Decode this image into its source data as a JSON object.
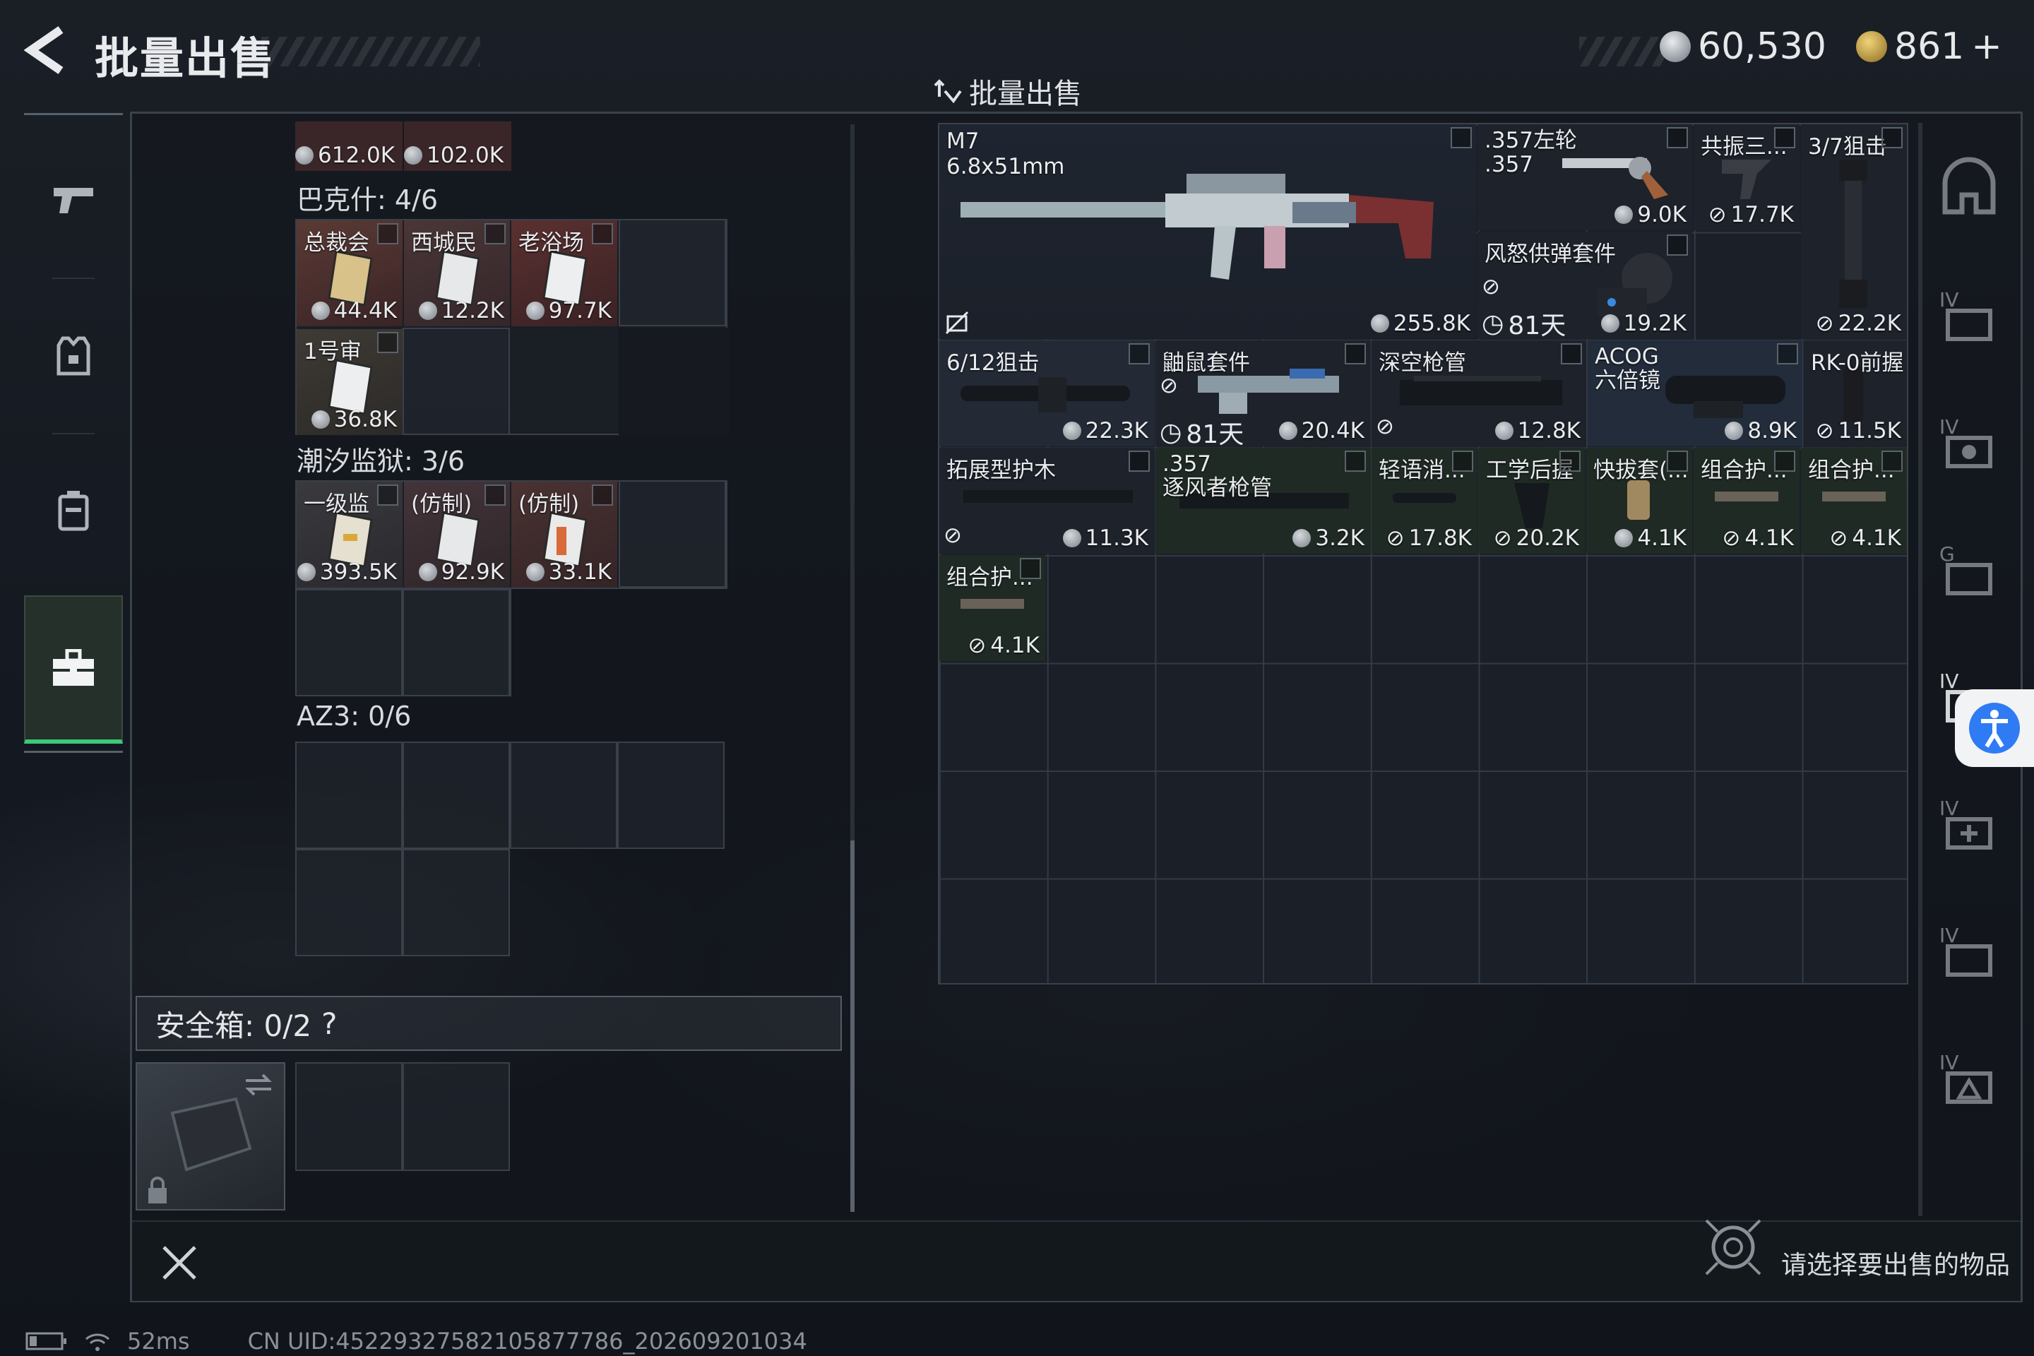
{
  "header": {
    "title": "批量出售",
    "subtitle": "批量出售",
    "currency_main": "60,530",
    "currency_secondary": "861",
    "add_label": "+"
  },
  "left_panel": {
    "top_row_prices": [
      "612.0K",
      "102.0K"
    ],
    "sections": [
      {
        "label": "巴克什: 4/6",
        "items": [
          {
            "name": "总裁会",
            "price": "44.4K"
          },
          {
            "name": "西城民",
            "price": "12.2K"
          },
          {
            "name": "老浴场",
            "price": "97.7K"
          },
          {
            "name": "1号审",
            "price": "36.8K"
          }
        ]
      },
      {
        "label": "潮汐监狱: 3/6",
        "items": [
          {
            "name": "一级监",
            "price": "393.5K"
          },
          {
            "name": "(仿制)",
            "price": "92.9K"
          },
          {
            "name": "(仿制)",
            "price": "33.1K"
          }
        ]
      },
      {
        "label": "AZ3: 0/6",
        "items": []
      }
    ],
    "safe_box_label": "安全箱: 0/2",
    "safe_box_help": "?"
  },
  "right_panel": {
    "items": [
      {
        "name": "M7\n6.8x51mm",
        "price": "255.8K"
      },
      {
        "name": ".357左轮\n.357",
        "price": "9.0K"
      },
      {
        "name": "共振三...",
        "price": "17.7K"
      },
      {
        "name": "3/7狙击",
        "price": "22.2K"
      },
      {
        "name": "风怒供弹套件",
        "price": "19.2K",
        "timer": "81天"
      },
      {
        "name": "6/12狙击",
        "price": "22.3K"
      },
      {
        "name": "鼬鼠套件",
        "price": "20.4K",
        "timer": "81天"
      },
      {
        "name": "深空枪管",
        "price": "12.8K"
      },
      {
        "name": "ACOG\n六倍镜",
        "price": "8.9K"
      },
      {
        "name": "RK-0前握",
        "price": "11.5K"
      },
      {
        "name": "拓展型护木",
        "price": "11.3K"
      },
      {
        "name": ".357\n逐风者枪管",
        "price": "3.2K"
      },
      {
        "name": "轻语消...",
        "price": "17.8K"
      },
      {
        "name": "工学后握",
        "price": "20.2K"
      },
      {
        "name": "快拔套(...",
        "price": "4.1K"
      },
      {
        "name": "组合护...",
        "price": "4.1K"
      },
      {
        "name": "组合护...",
        "price": "4.1K"
      },
      {
        "name": "组合护...",
        "price": "4.1K"
      }
    ]
  },
  "footer": {
    "hint": "请选择要出售的物品",
    "ping": "52ms",
    "uid": "CN UID:4522932758210587778​6_202609201034"
  },
  "colors": {
    "accent": "#3ec87a",
    "rare_red": "#4a2a2a",
    "rare_gold": "#5a4a2a",
    "item_blue": "#222c3a"
  }
}
